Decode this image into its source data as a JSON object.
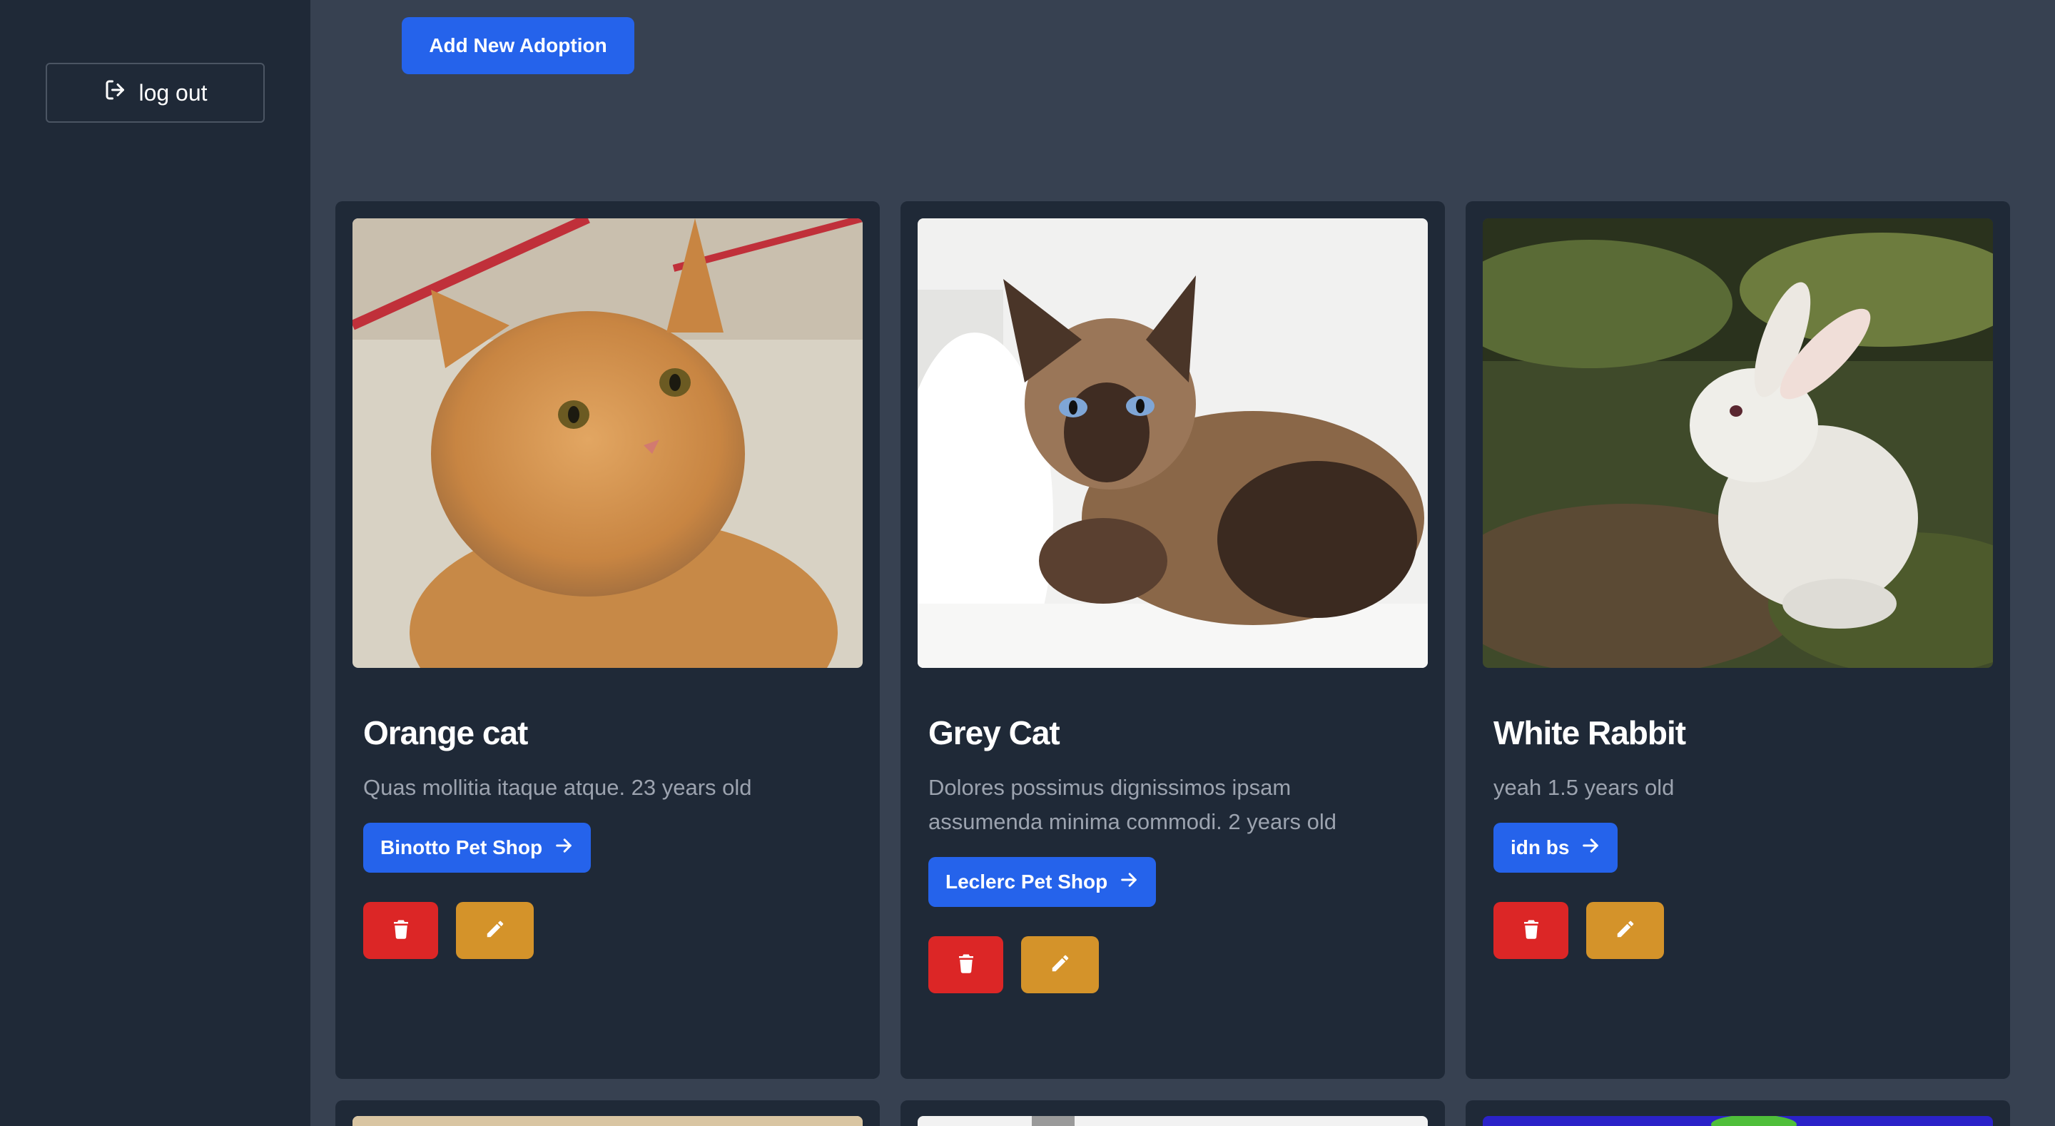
{
  "sidebar": {
    "logout_label": "log out"
  },
  "main": {
    "add_label": "Add New Adoption"
  },
  "cards": [
    {
      "title": "Orange cat",
      "description": "Quas mollitia itaque atque. 23 years old",
      "shop": "Binotto Pet Shop"
    },
    {
      "title": "Grey Cat",
      "description": "Dolores possimus dignissimos ipsam assumenda minima commodi. 2 years old",
      "shop": "Leclerc Pet Shop"
    },
    {
      "title": "White Rabbit",
      "description": "yeah 1.5 years old",
      "shop": "idn bs"
    }
  ],
  "colors": {
    "background": "#374151",
    "sidebar": "#1f2937",
    "card": "#1f2937",
    "primary": "#2563eb",
    "danger": "#dc2626",
    "warning": "#d4932a",
    "muted_text": "#9ca3af"
  },
  "icons": {
    "logout": "logout-icon",
    "arrow": "arrow-right-icon",
    "delete": "trash-icon",
    "edit": "pencil-icon"
  }
}
